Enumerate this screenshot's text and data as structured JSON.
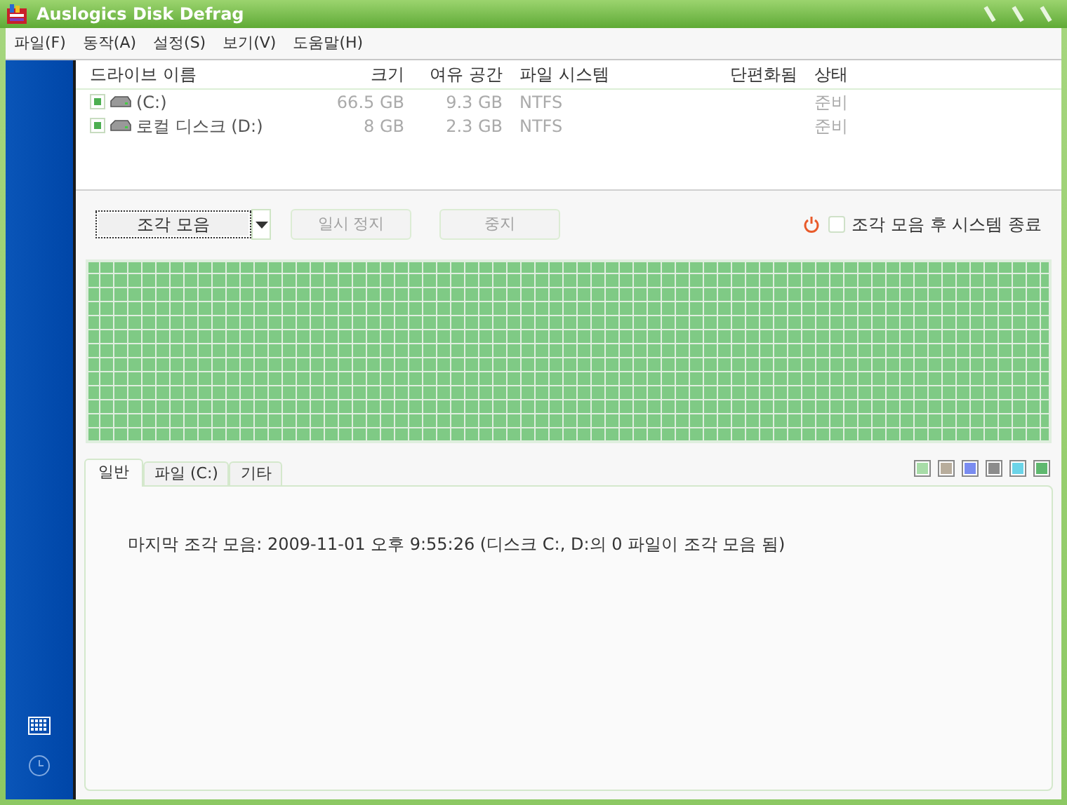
{
  "window": {
    "title": "Auslogics Disk Defrag"
  },
  "menu": [
    "파일(F)",
    "동작(A)",
    "설정(S)",
    "보기(V)",
    "도움말(H)"
  ],
  "drives": {
    "columns": [
      "드라이브 이름",
      "크기",
      "여유 공간",
      "파일 시스템",
      "단편화됨",
      "상태"
    ],
    "rows": [
      {
        "checked": true,
        "name": "(C:)",
        "size": "66.5 GB",
        "free": "9.3 GB",
        "fs": "NTFS",
        "status": "준비"
      },
      {
        "checked": true,
        "name": "로컬 디스크 (D:)",
        "size": "8 GB",
        "free": "2.3 GB",
        "fs": "NTFS",
        "status": "준비"
      }
    ]
  },
  "actions": {
    "defrag": "조각 모음",
    "pause": {
      "label": "일시 정지",
      "disabled": true
    },
    "stop": {
      "label": "중지",
      "disabled": true
    },
    "shutdown": {
      "label": "조각 모음 후 시스템 종료",
      "checked": false
    }
  },
  "tabs": [
    {
      "label": "일반",
      "selected": true
    },
    {
      "label": "파일 (C:)",
      "selected": false
    },
    {
      "label": "기타",
      "selected": false
    }
  ],
  "legend": [
    {
      "color": "#a8dca8"
    },
    {
      "color": "#b8ad9c"
    },
    {
      "color": "#7a8cf0"
    },
    {
      "color": "#8c8c8c"
    },
    {
      "color": "#6cd4e8"
    },
    {
      "color": "#5fb86f"
    }
  ],
  "summary": "마지막 조각 모음: 2009-11-01 오후 9:55:26 (디스크 C:, D:의 0 파일이 조각 모음 됨)"
}
